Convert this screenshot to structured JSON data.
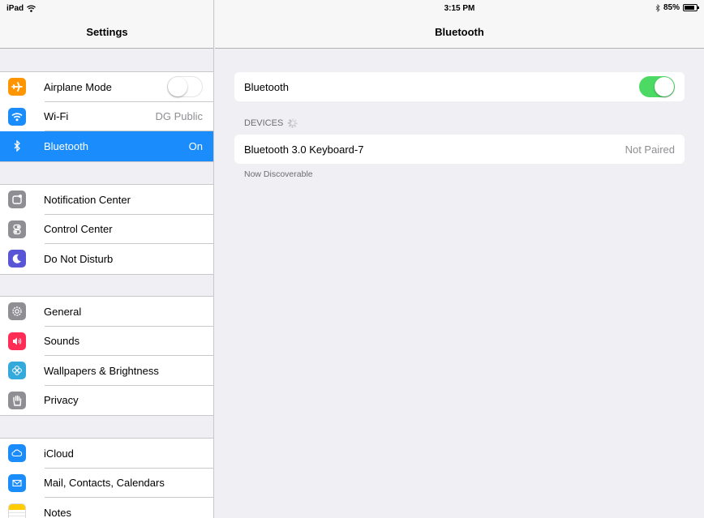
{
  "status_bar": {
    "device": "iPad",
    "time": "3:15 PM",
    "battery_percent": "85%",
    "battery_level": 0.85
  },
  "sidebar": {
    "title": "Settings",
    "groups": [
      {
        "items": [
          {
            "label": "Airplane Mode",
            "icon": "airplane-icon",
            "color": "#ff9500",
            "toggle": "off"
          },
          {
            "label": "Wi-Fi",
            "icon": "wifi-icon",
            "color": "#1a8cfc",
            "value": "DG Public"
          },
          {
            "label": "Bluetooth",
            "icon": "bluetooth-icon",
            "color": "#1a8cfc",
            "value": "On",
            "selected": true
          }
        ]
      },
      {
        "items": [
          {
            "label": "Notification Center",
            "icon": "notification-center-icon",
            "color": "#8e8e93"
          },
          {
            "label": "Control Center",
            "icon": "control-center-icon",
            "color": "#8e8e93"
          },
          {
            "label": "Do Not Disturb",
            "icon": "moon-icon",
            "color": "#5856d6"
          }
        ]
      },
      {
        "items": [
          {
            "label": "General",
            "icon": "gear-icon",
            "color": "#8e8e93"
          },
          {
            "label": "Sounds",
            "icon": "speaker-icon",
            "color": "#ff2d55"
          },
          {
            "label": "Wallpapers & Brightness",
            "icon": "flower-icon",
            "color": "#34aadc"
          },
          {
            "label": "Privacy",
            "icon": "hand-icon",
            "color": "#8e8e93"
          }
        ]
      },
      {
        "items": [
          {
            "label": "iCloud",
            "icon": "cloud-icon",
            "color": "#1a8cfc"
          },
          {
            "label": "Mail, Contacts, Calendars",
            "icon": "mail-icon",
            "color": "#1a8cfc"
          },
          {
            "label": "Notes",
            "icon": "notes-icon",
            "color": "#ffcc00"
          }
        ]
      }
    ]
  },
  "detail": {
    "title": "Bluetooth",
    "bluetooth_row": {
      "label": "Bluetooth",
      "toggle": "on"
    },
    "devices_header": "DEVICES",
    "devices": [
      {
        "name": "Bluetooth 3.0 Keyboard-7",
        "status": "Not Paired"
      }
    ],
    "footer": "Now Discoverable"
  },
  "colors": {
    "accent": "#1a8cfc",
    "toggle_on": "#4cd964",
    "background": "#efeff4"
  }
}
